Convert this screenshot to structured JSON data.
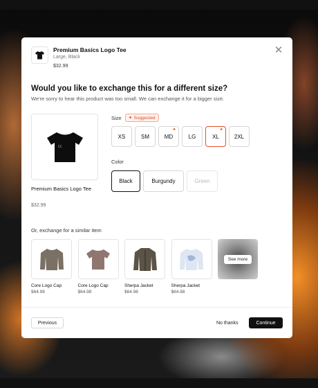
{
  "modal": {
    "close_icon": "close-icon",
    "product": {
      "name": "Premium Basics Logo Tee",
      "variant": "Large, Black",
      "price": "$32.99"
    },
    "question_title": "Would you like to exchange this for a different size?",
    "question_subtitle": "We're sorry to hear this product was too small. We can exchange it for a bigger size.",
    "main_product": {
      "name": "Premium Basics Logo Tee",
      "price": "$32.99"
    },
    "size": {
      "label": "Size",
      "suggested_badge": "Suggested",
      "options": [
        "XS",
        "SM",
        "MD",
        "LG",
        "XL",
        "2XL"
      ],
      "selected": "XL",
      "flagged": [
        "MD",
        "XL"
      ]
    },
    "color": {
      "label": "Color",
      "options": [
        "Black",
        "Burgundy",
        "Green"
      ],
      "selected": "Black",
      "disabled": [
        "Green"
      ]
    },
    "similar": {
      "label": "Or, exchange for a similar item",
      "items": [
        {
          "name": "Core Logo Cap",
          "price": "$64.98"
        },
        {
          "name": "Core Logo Cap",
          "price": "$64.98"
        },
        {
          "name": "Sherpa Jacket",
          "price": "$64.98"
        },
        {
          "name": "Sherpa Jacket",
          "price": "$64.98"
        }
      ],
      "see_more": "See more"
    },
    "footer": {
      "previous": "Previous",
      "no_thanks": "No thanks",
      "continue": "Continue"
    }
  },
  "colors": {
    "accent": "#e0502a",
    "primary": "#111111"
  }
}
